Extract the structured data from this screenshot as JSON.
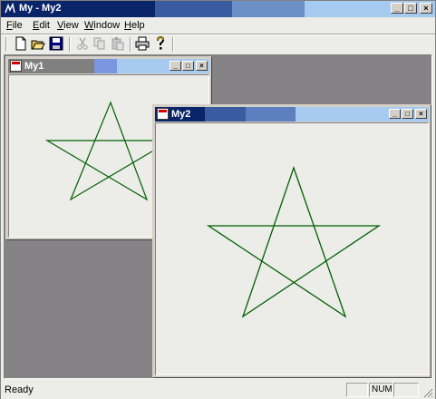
{
  "window": {
    "title": "My - My2"
  },
  "menu": [
    {
      "label": "File",
      "ul": "F",
      "rest": "ile"
    },
    {
      "label": "Edit",
      "ul": "E",
      "rest": "dit"
    },
    {
      "label": "View",
      "ul": "V",
      "rest": "iew"
    },
    {
      "label": "Window",
      "ul": "W",
      "rest": "indow"
    },
    {
      "label": "Help",
      "ul": "H",
      "rest": "elp"
    }
  ],
  "toolbar": [
    {
      "icon": "new-icon",
      "enabled": true
    },
    {
      "icon": "open-icon",
      "enabled": true
    },
    {
      "icon": "save-icon",
      "enabled": true
    },
    {
      "icon": "cut-icon",
      "enabled": false
    },
    {
      "icon": "copy-icon",
      "enabled": false
    },
    {
      "icon": "paste-icon",
      "enabled": false
    },
    {
      "icon": "print-icon",
      "enabled": true
    },
    {
      "icon": "about-icon",
      "enabled": true
    }
  ],
  "children": [
    {
      "title": "My1",
      "active": false
    },
    {
      "title": "My2",
      "active": true
    }
  ],
  "status": {
    "text": "Ready",
    "indicator_num": "NUM"
  },
  "colors": {
    "star_stroke": "#006000",
    "mdi_background": "#848284",
    "active_title": "#0A246A"
  },
  "window_buttons": {
    "minimize": "_",
    "maximize": "□",
    "close": "×"
  }
}
